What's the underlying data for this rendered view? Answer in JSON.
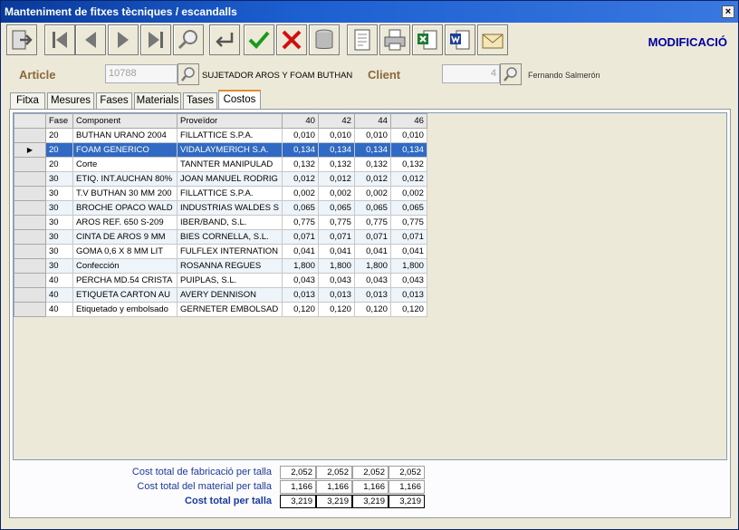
{
  "window": {
    "title": "Manteniment de fitxes tècniques / escandalls",
    "close": "×"
  },
  "toolbar": {
    "mode": "MODIFICACIÓ"
  },
  "article": {
    "label": "Article",
    "code": "10788",
    "description": "SUJETADOR AROS Y FOAM BUTHAN"
  },
  "client": {
    "label": "Client",
    "code": "4",
    "name": "Fernando Salmerón"
  },
  "tabs": [
    {
      "label": "Fitxa"
    },
    {
      "label": "Mesures"
    },
    {
      "label": "Fases"
    },
    {
      "label": "Materials"
    },
    {
      "label": "Tases"
    },
    {
      "label": "Costos"
    }
  ],
  "grid": {
    "columns": [
      "Fase",
      "Component",
      "Proveïdor",
      "40",
      "42",
      "44",
      "46"
    ],
    "rows": [
      {
        "fase": "20",
        "component": "BUTHAN URANO 2004",
        "proveidor": "FILLATTICE S.P.A.",
        "v40": "0,010",
        "v42": "0,010",
        "v44": "0,010",
        "v46": "0,010"
      },
      {
        "fase": "20",
        "component": "FOAM GENERICO",
        "proveidor": "VIDALAYMERICH S.A.",
        "v40": "0,134",
        "v42": "0,134",
        "v44": "0,134",
        "v46": "0,134"
      },
      {
        "fase": "20",
        "component": "Corte",
        "proveidor": "TANNTER MANIPULAD",
        "v40": "0,132",
        "v42": "0,132",
        "v44": "0,132",
        "v46": "0,132"
      },
      {
        "fase": "30",
        "component": "ETIQ. INT.AUCHAN 80%",
        "proveidor": "JOAN MANUEL RODRIG",
        "v40": "0,012",
        "v42": "0,012",
        "v44": "0,012",
        "v46": "0,012"
      },
      {
        "fase": "30",
        "component": "T.V BUTHAN 30 MM 200",
        "proveidor": "FILLATTICE S.P.A.",
        "v40": "0,002",
        "v42": "0,002",
        "v44": "0,002",
        "v46": "0,002"
      },
      {
        "fase": "30",
        "component": "BROCHE OPACO WALD",
        "proveidor": "INDUSTRIAS WALDES S",
        "v40": "0,065",
        "v42": "0,065",
        "v44": "0,065",
        "v46": "0,065"
      },
      {
        "fase": "30",
        "component": "AROS REF. 650 S-209",
        "proveidor": "IBER/BAND, S.L.",
        "v40": "0,775",
        "v42": "0,775",
        "v44": "0,775",
        "v46": "0,775"
      },
      {
        "fase": "30",
        "component": "CINTA DE AROS 9 MM",
        "proveidor": "BIES CORNELLA, S.L.",
        "v40": "0,071",
        "v42": "0,071",
        "v44": "0,071",
        "v46": "0,071"
      },
      {
        "fase": "30",
        "component": "GOMA 0,6 X 8 MM LIT",
        "proveidor": "FULFLEX INTERNATION",
        "v40": "0,041",
        "v42": "0,041",
        "v44": "0,041",
        "v46": "0,041"
      },
      {
        "fase": "30",
        "component": "Confección",
        "proveidor": "ROSANNA REGUES",
        "v40": "1,800",
        "v42": "1,800",
        "v44": "1,800",
        "v46": "1,800"
      },
      {
        "fase": "40",
        "component": "PERCHA MD.54 CRISTA",
        "proveidor": "PUIPLAS, S.L.",
        "v40": "0,043",
        "v42": "0,043",
        "v44": "0,043",
        "v46": "0,043"
      },
      {
        "fase": "40",
        "component": "ETIQUETA CARTON AU",
        "proveidor": "AVERY DENNISON",
        "v40": "0,013",
        "v42": "0,013",
        "v44": "0,013",
        "v46": "0,013"
      },
      {
        "fase": "40",
        "component": "Etiquetado y embolsado",
        "proveidor": "GERNETER EMBOLSAD",
        "v40": "0,120",
        "v42": "0,120",
        "v44": "0,120",
        "v46": "0,120"
      }
    ]
  },
  "totals": [
    {
      "label": "Cost total de fabricació per talla",
      "values": [
        "2,052",
        "2,052",
        "2,052",
        "2,052"
      ]
    },
    {
      "label": "Cost total del material per talla",
      "values": [
        "1,166",
        "1,166",
        "1,166",
        "1,166"
      ]
    },
    {
      "label": "Cost total per talla",
      "values": [
        "3,219",
        "3,219",
        "3,219",
        "3,219"
      ]
    }
  ]
}
